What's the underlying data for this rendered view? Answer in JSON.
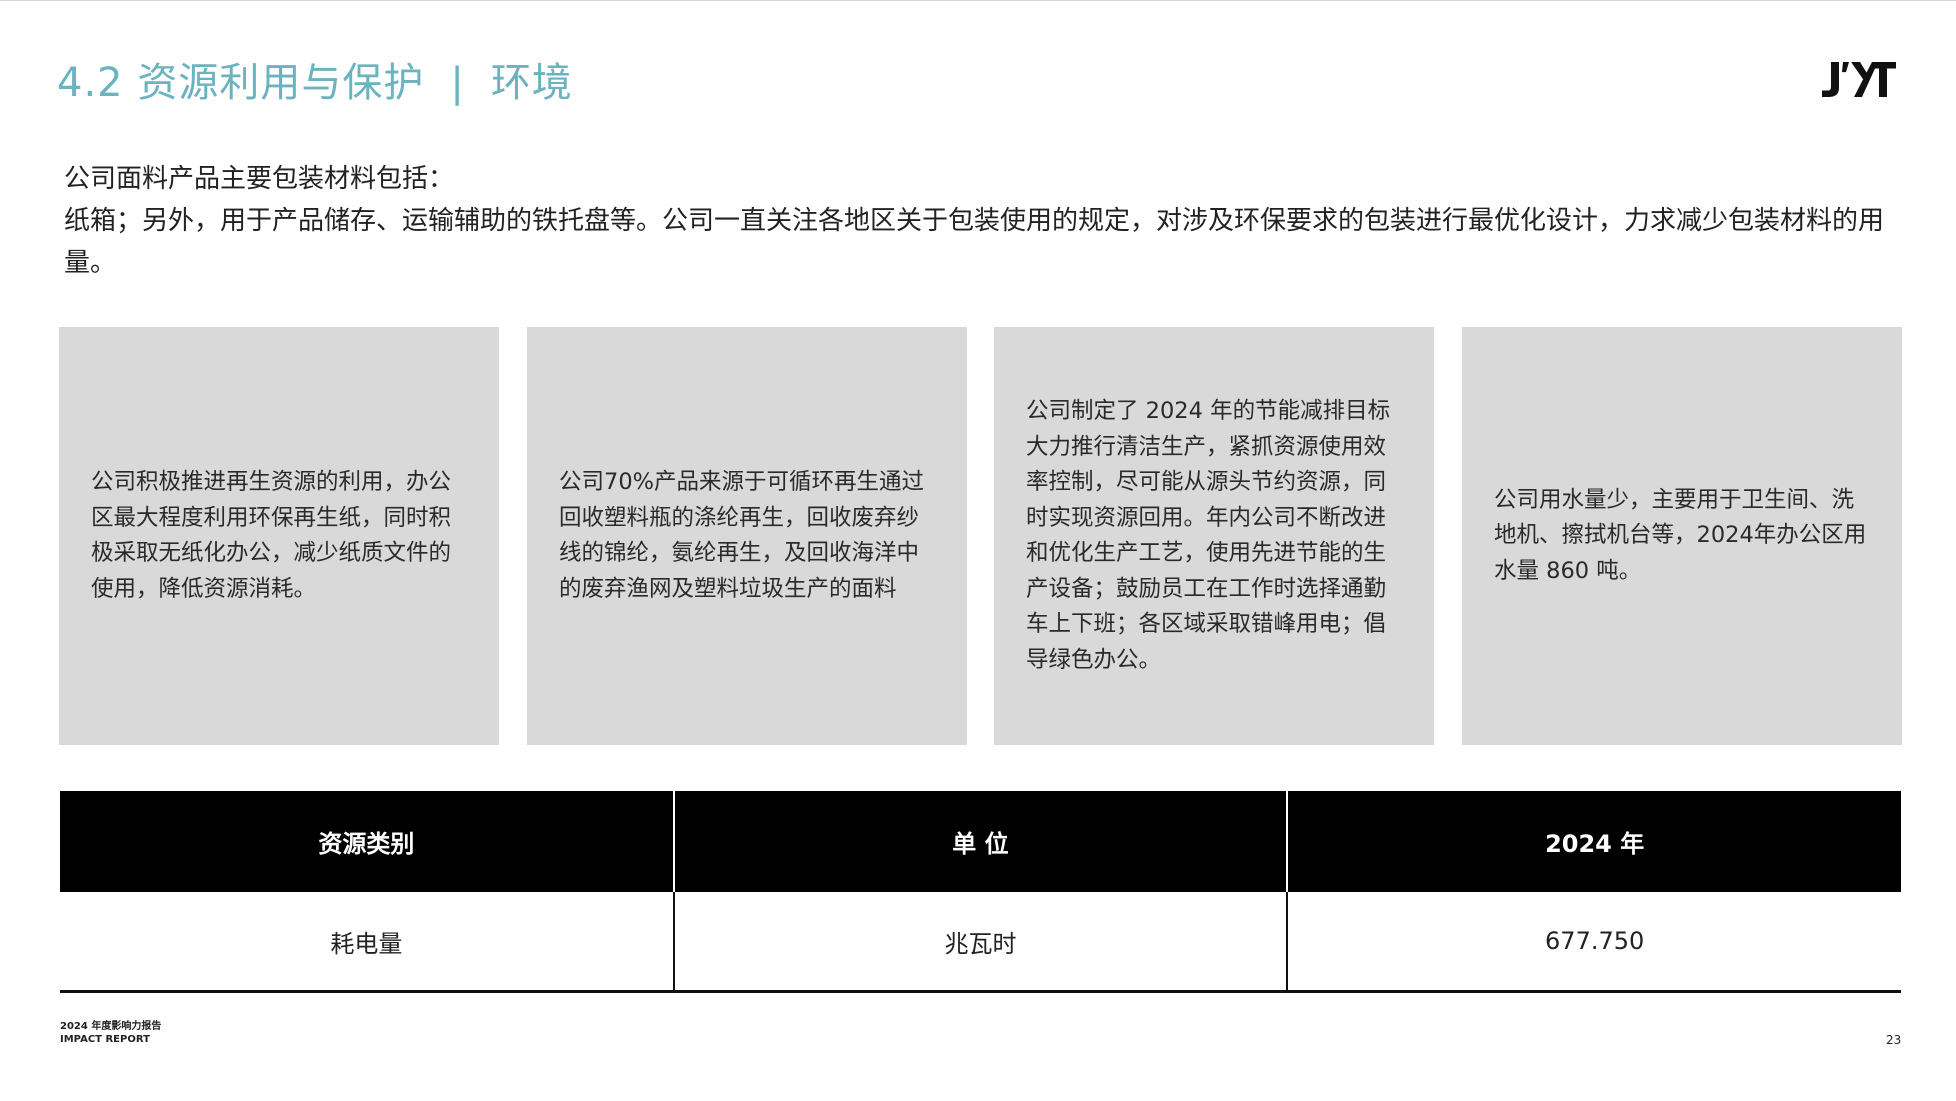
{
  "header": {
    "section": "4.2 资源利用与保护",
    "separator": "|",
    "category": "环境",
    "logo": "J'YT"
  },
  "intro": {
    "line1": "公司面料产品主要包装材料包括：",
    "line2": "纸箱；另外，用于产品储存、运输辅助的铁托盘等。公司一直关注各地区关于包装使用的规定，对涉及环保要求的包装进行最优化设计，力求减少包装材料的用量。"
  },
  "cards": [
    {
      "text": "公司积极推进再生资源的利用，办公区最大程度利用环保再生纸，同时积极采取无纸化办公，减少纸质文件的使用，降低资源消耗。"
    },
    {
      "text": "公司70%产品来源于可循环再生通过回收塑料瓶的涤纶再生，回收废弃纱线的锦纶，氨纶再生，及回收海洋中的废弃渔网及塑料垃圾生产的面料"
    },
    {
      "text": "公司制定了 2024 年的节能减排目标大力推行清洁生产，紧抓资源使用效率控制，尽可能从源头节约资源，同时实现资源回用。年内公司不断改进和优化生产工艺，使用先进节能的生产设备；鼓励员工在工作时选择通勤车上下班；各区域采取错峰用电；倡导绿色办公。"
    },
    {
      "text": "公司用水量少，主要用于卫生间、洗地机、擦拭机台等，2024年办公区用水量 860 吨。"
    }
  ],
  "table": {
    "headers": [
      "资源类别",
      "单 位",
      "2024 年"
    ],
    "rows": [
      [
        "耗电量",
        "兆瓦时",
        "677.750"
      ]
    ]
  },
  "footer": {
    "report_cn": "2024 年度影响力报告",
    "report_en": "IMPACT REPORT",
    "page": "23"
  },
  "colors": {
    "accent": "#6bb3be",
    "card_bg": "#d9d9d9",
    "table_header_bg": "#000000"
  }
}
